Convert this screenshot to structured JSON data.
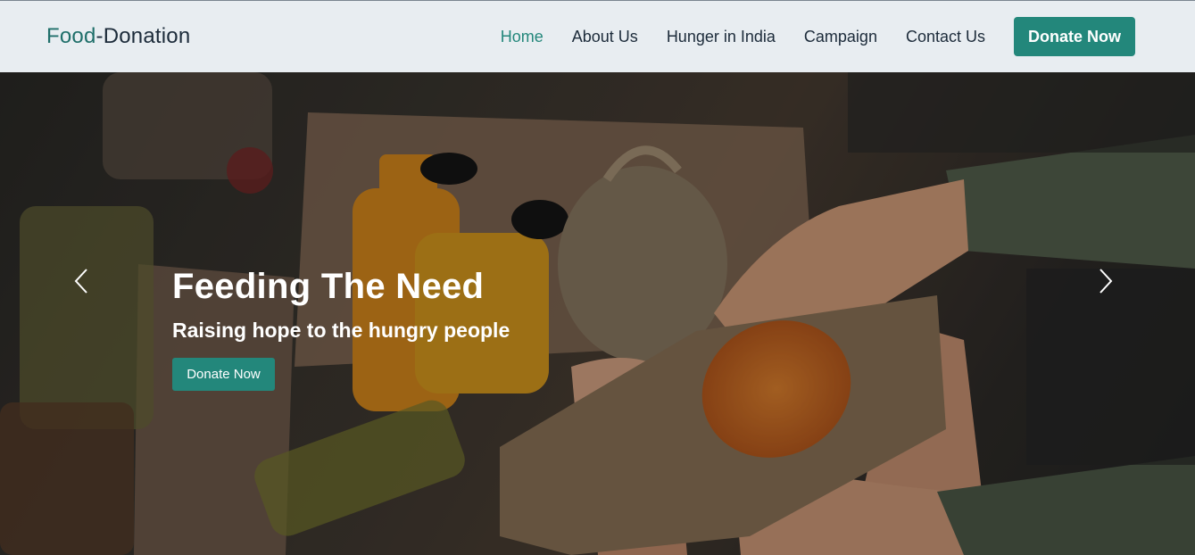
{
  "brand": {
    "part1": "Food",
    "separator": "-",
    "part2": "Donation"
  },
  "nav": {
    "items": [
      {
        "label": "Home",
        "active": true
      },
      {
        "label": "About Us",
        "active": false
      },
      {
        "label": "Hunger in India",
        "active": false
      },
      {
        "label": "Campaign",
        "active": false
      },
      {
        "label": "Contact Us",
        "active": false
      }
    ],
    "cta_label": "Donate Now"
  },
  "hero": {
    "title": "Feeding The Need",
    "subtitle": "Raising hope to the hungry people",
    "button_label": "Donate Now",
    "prev_icon": "chevron-left-icon",
    "next_icon": "chevron-right-icon"
  },
  "colors": {
    "accent": "#23877b",
    "brand_accent": "#1f6f6a",
    "navbar_bg": "#e8edf1",
    "text_dark": "#1c2b3a"
  }
}
